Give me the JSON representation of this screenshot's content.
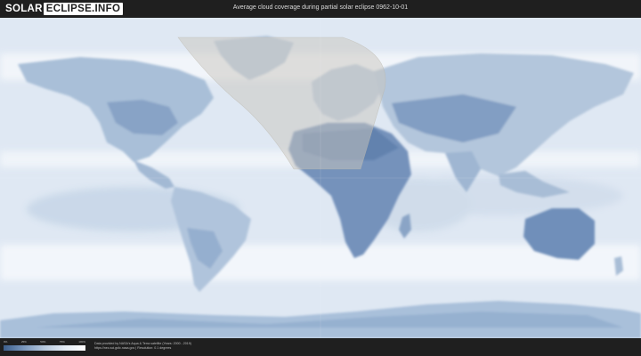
{
  "header": {
    "logo_part1": "SOLAR",
    "logo_part2": "ECLIPSE.INFO",
    "title": "Average cloud coverage during partial solar eclipse 0962-10-01"
  },
  "legend": {
    "ticks": [
      "0%",
      "25%",
      "50%",
      "75%",
      "100%"
    ],
    "colors": [
      "#3d5f8c",
      "#7b98bd",
      "#b7c9de",
      "#e4ecf5",
      "#ffffff"
    ]
  },
  "footer": {
    "credit_line1": "Data provided by NASA's Aqua & Terra satellite (Years: 2000 - 2019)",
    "credit_line2": "https://neo.sci.gsfc.nasa.gov | Resolution: 0.1 degrees"
  },
  "colors": {
    "background": "#1f1f1f",
    "ocean_cloud": "#e9eff6",
    "land_clear": "#6d8fb8",
    "eclipse_shade": "#c9c6bd"
  }
}
